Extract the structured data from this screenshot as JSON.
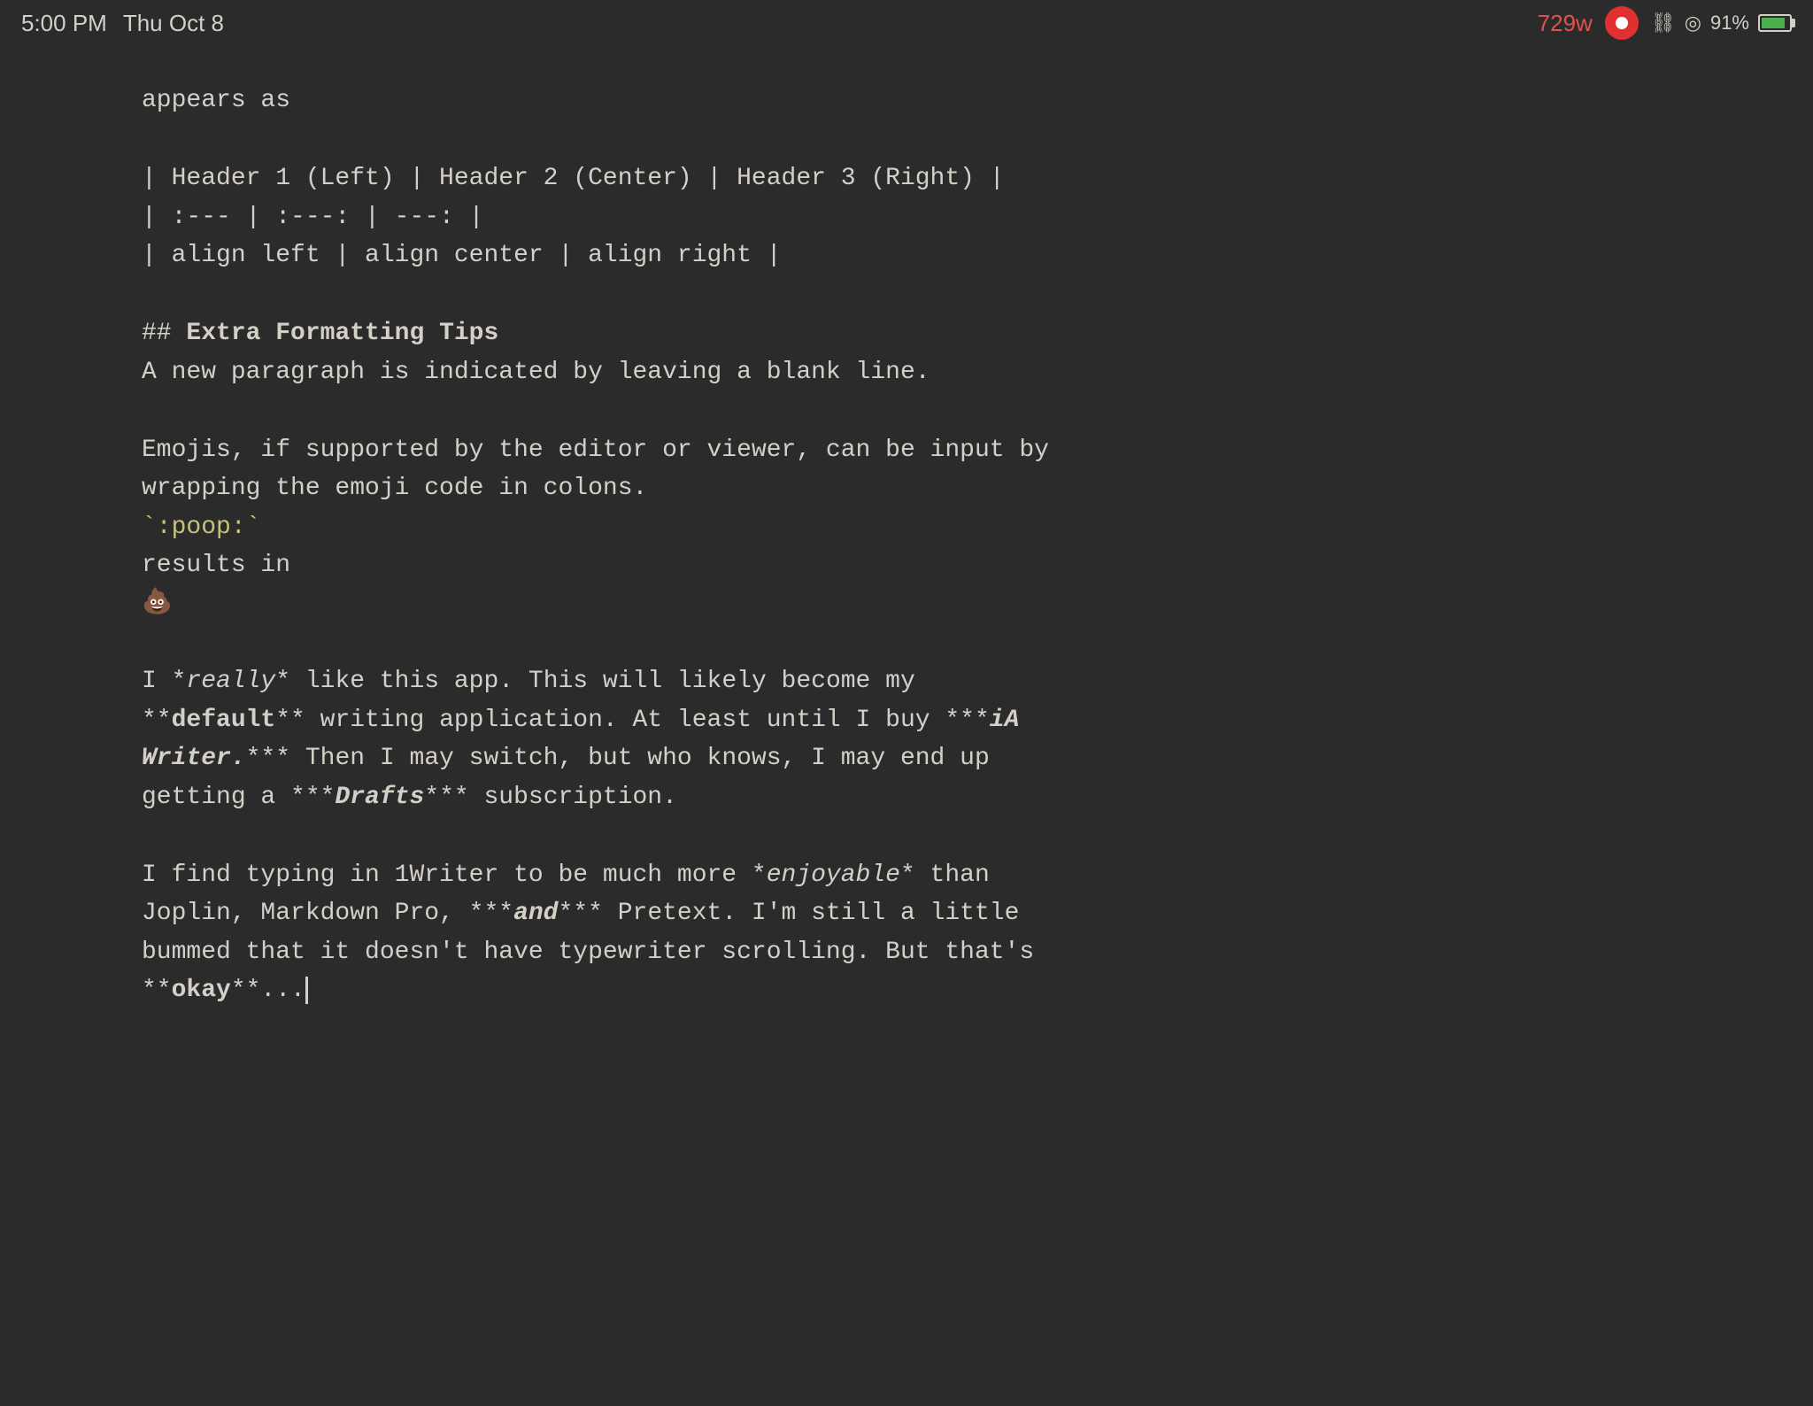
{
  "statusBar": {
    "time": "5:00 PM",
    "date": "Thu Oct 8",
    "wordCount": "729w",
    "batteryPercent": "91%"
  },
  "content": {
    "lines": [
      {
        "id": "appears-as",
        "text": "appears as",
        "type": "normal"
      },
      {
        "id": "gap1",
        "type": "gap"
      },
      {
        "id": "table-header",
        "text": "| Header 1 (Left) | Header 2 (Center) | Header 3 (Right) |",
        "type": "normal"
      },
      {
        "id": "table-align",
        "text": "| :--- | :---: | ---: |",
        "type": "normal"
      },
      {
        "id": "table-data",
        "text": "| align left | align center | align right |",
        "type": "normal"
      },
      {
        "id": "gap2",
        "type": "gap"
      },
      {
        "id": "heading",
        "type": "heading2",
        "hash": "## ",
        "text": "Extra Formatting Tips"
      },
      {
        "id": "new-para",
        "text": "A new paragraph is indicated by leaving a blank line.",
        "type": "normal"
      },
      {
        "id": "gap3",
        "type": "gap"
      },
      {
        "id": "emojis-line1",
        "text": "Emojis, if supported by the editor or viewer, can be input by",
        "type": "normal"
      },
      {
        "id": "emojis-line2",
        "text": "wrapping the emoji code in colons.",
        "type": "normal"
      },
      {
        "id": "poop-code",
        "type": "code-line",
        "text": "`:poop:`"
      },
      {
        "id": "results-in",
        "text": "results in",
        "type": "normal"
      },
      {
        "id": "emoji-result",
        "type": "emoji",
        "text": "💩"
      },
      {
        "id": "gap4",
        "type": "gap"
      },
      {
        "id": "really-line1",
        "type": "mixed1",
        "segments": [
          {
            "text": "I *",
            "style": "normal"
          },
          {
            "text": "really",
            "style": "italic"
          },
          {
            "text": "* like this app. This will likely become my",
            "style": "normal"
          }
        ]
      },
      {
        "id": "really-line2",
        "type": "mixed2",
        "segments": [
          {
            "text": "**",
            "style": "normal"
          },
          {
            "text": "default",
            "style": "bold"
          },
          {
            "text": "** writing application. At least until I buy ***",
            "style": "normal"
          },
          {
            "text": "iA",
            "style": "bold-italic"
          },
          {
            "text": "",
            "style": "normal"
          }
        ]
      },
      {
        "id": "really-line3",
        "type": "mixed3",
        "segments": [
          {
            "text": "Writer.",
            "style": "bold-italic"
          },
          {
            "text": "*** Then I may switch, but who knows, I may end up",
            "style": "normal"
          }
        ]
      },
      {
        "id": "really-line4",
        "type": "mixed4",
        "segments": [
          {
            "text": "getting a ***",
            "style": "normal"
          },
          {
            "text": "Drafts",
            "style": "bold-italic"
          },
          {
            "text": "*** subscription.",
            "style": "normal"
          }
        ]
      },
      {
        "id": "gap5",
        "type": "gap"
      },
      {
        "id": "find-line1",
        "type": "mixed5",
        "segments": [
          {
            "text": "I find typing in 1Writer to be much more *",
            "style": "normal"
          },
          {
            "text": "enjoyable",
            "style": "italic"
          },
          {
            "text": "* than",
            "style": "normal"
          }
        ]
      },
      {
        "id": "find-line2",
        "type": "mixed6",
        "segments": [
          {
            "text": "Joplin, Markdown Pro, ***",
            "style": "normal"
          },
          {
            "text": "and",
            "style": "bold-italic"
          },
          {
            "text": "*** Pretext. I’m still a little",
            "style": "normal"
          }
        ]
      },
      {
        "id": "find-line3",
        "text": "bummed that it doesn’t have typewriter scrolling. But that’s",
        "type": "normal"
      },
      {
        "id": "find-line4",
        "type": "last-line",
        "segments": [
          {
            "text": "**",
            "style": "normal"
          },
          {
            "text": "okay",
            "style": "bold"
          },
          {
            "text": "**...",
            "style": "normal"
          }
        ]
      }
    ]
  }
}
